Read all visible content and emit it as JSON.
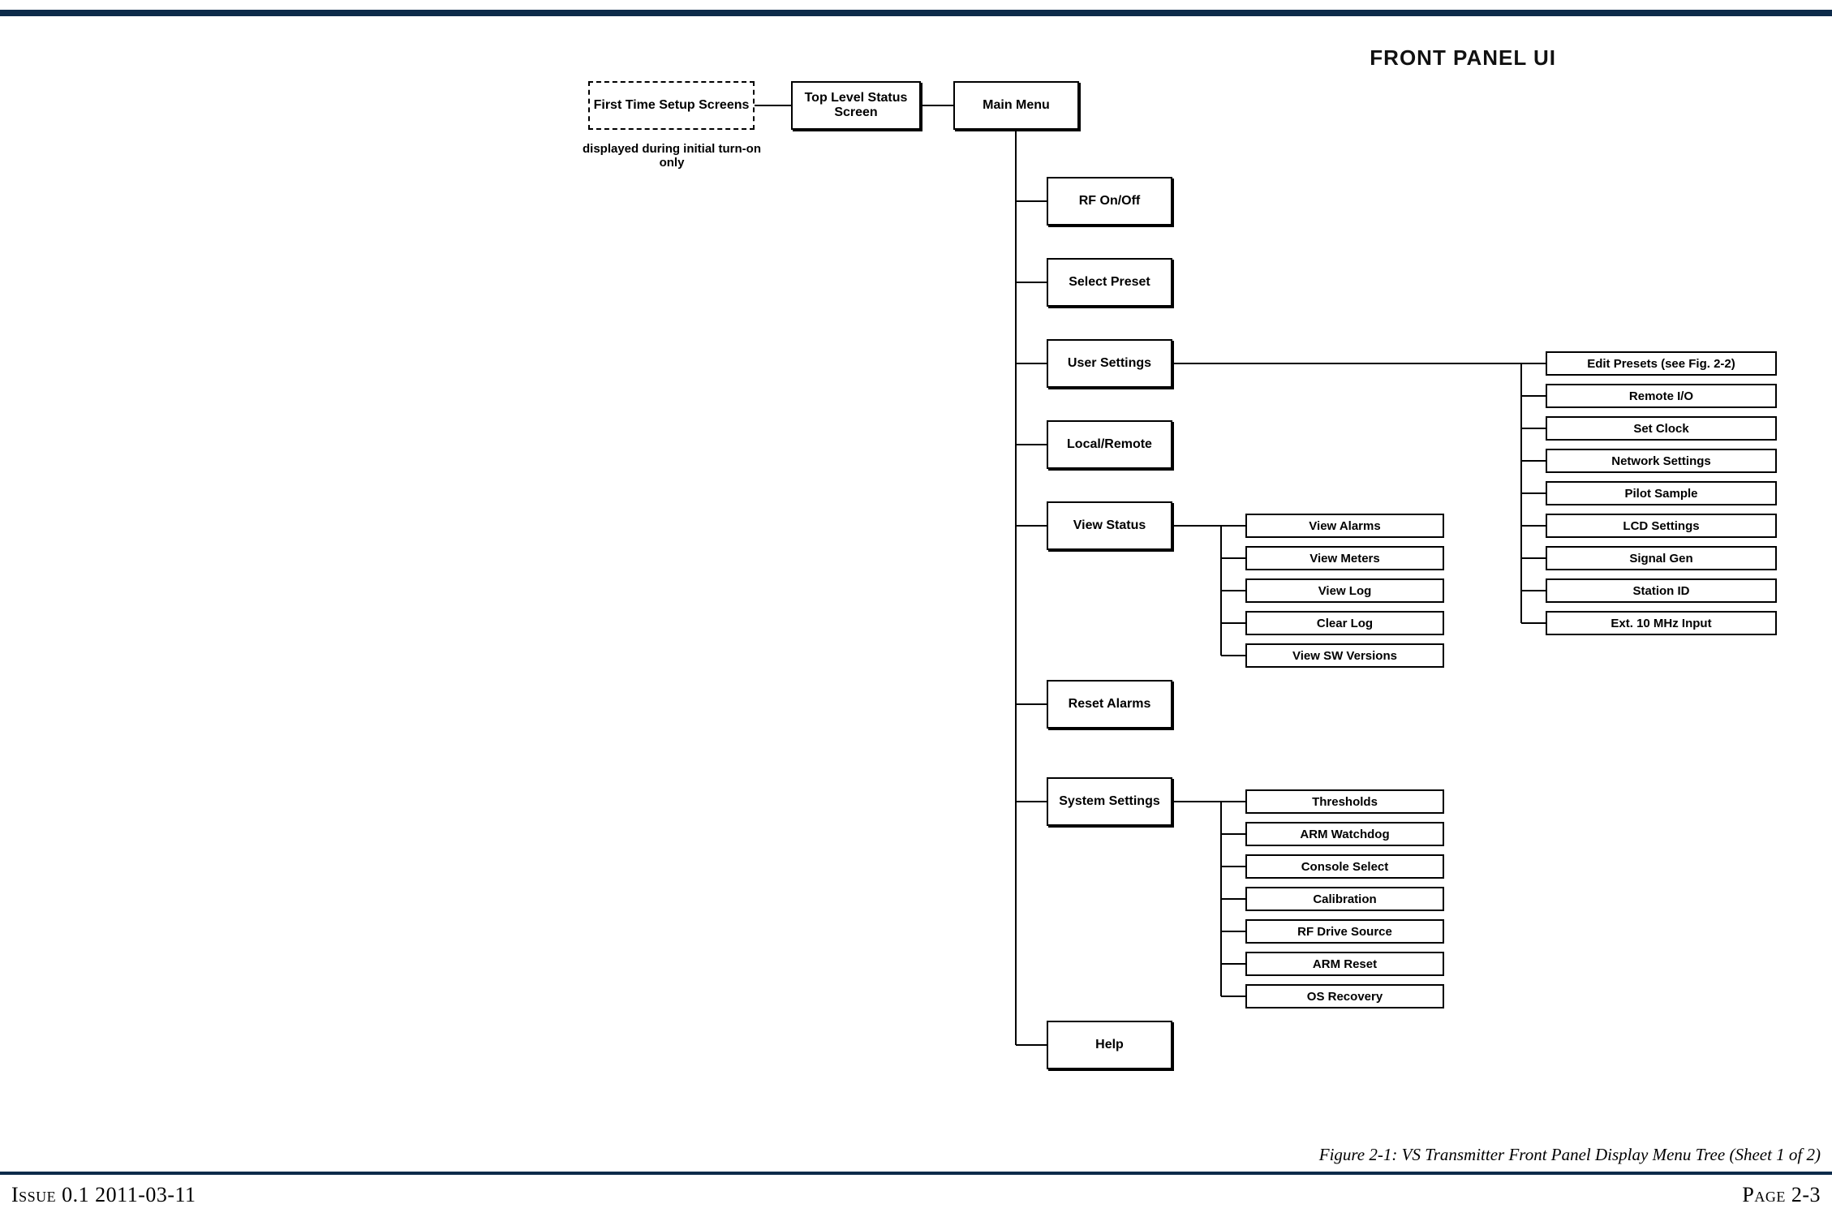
{
  "header": {
    "title": "FRONT PANEL UI"
  },
  "footer": {
    "issue": "Issue 0.1 2011-03-11",
    "page": "Page 2-3"
  },
  "caption": "Figure 2-1: VS Transmitter Front Panel Display Menu Tree (Sheet 1 of 2)",
  "nodes": {
    "first_time": "First Time Setup Screens",
    "first_time_note": "displayed during initial turn-on only",
    "top_level": "Top Level Status Screen",
    "main_menu": "Main Menu",
    "menu": {
      "rf": "RF On/Off",
      "select_preset": "Select Preset",
      "user_settings": "User Settings",
      "local_remote": "Local/Remote",
      "view_status": "View Status",
      "reset_alarms": "Reset Alarms",
      "system_settings": "System Settings",
      "help": "Help"
    },
    "view_status_sub": {
      "0": "View Alarms",
      "1": "View Meters",
      "2": "View Log",
      "3": "Clear Log",
      "4": "View SW Versions"
    },
    "system_settings_sub": {
      "0": "Thresholds",
      "1": "ARM Watchdog",
      "2": "Console Select",
      "3": "Calibration",
      "4": "RF Drive Source",
      "5": "ARM Reset",
      "6": "OS Recovery"
    },
    "user_settings_sub": {
      "0": "Edit Presets (see Fig. 2-2)",
      "1": "Remote I/O",
      "2": "Set Clock",
      "3": "Network Settings",
      "4": "Pilot Sample",
      "5": "LCD Settings",
      "6": "Signal Gen",
      "7": "Station ID",
      "8": "Ext. 10 MHz Input"
    }
  }
}
